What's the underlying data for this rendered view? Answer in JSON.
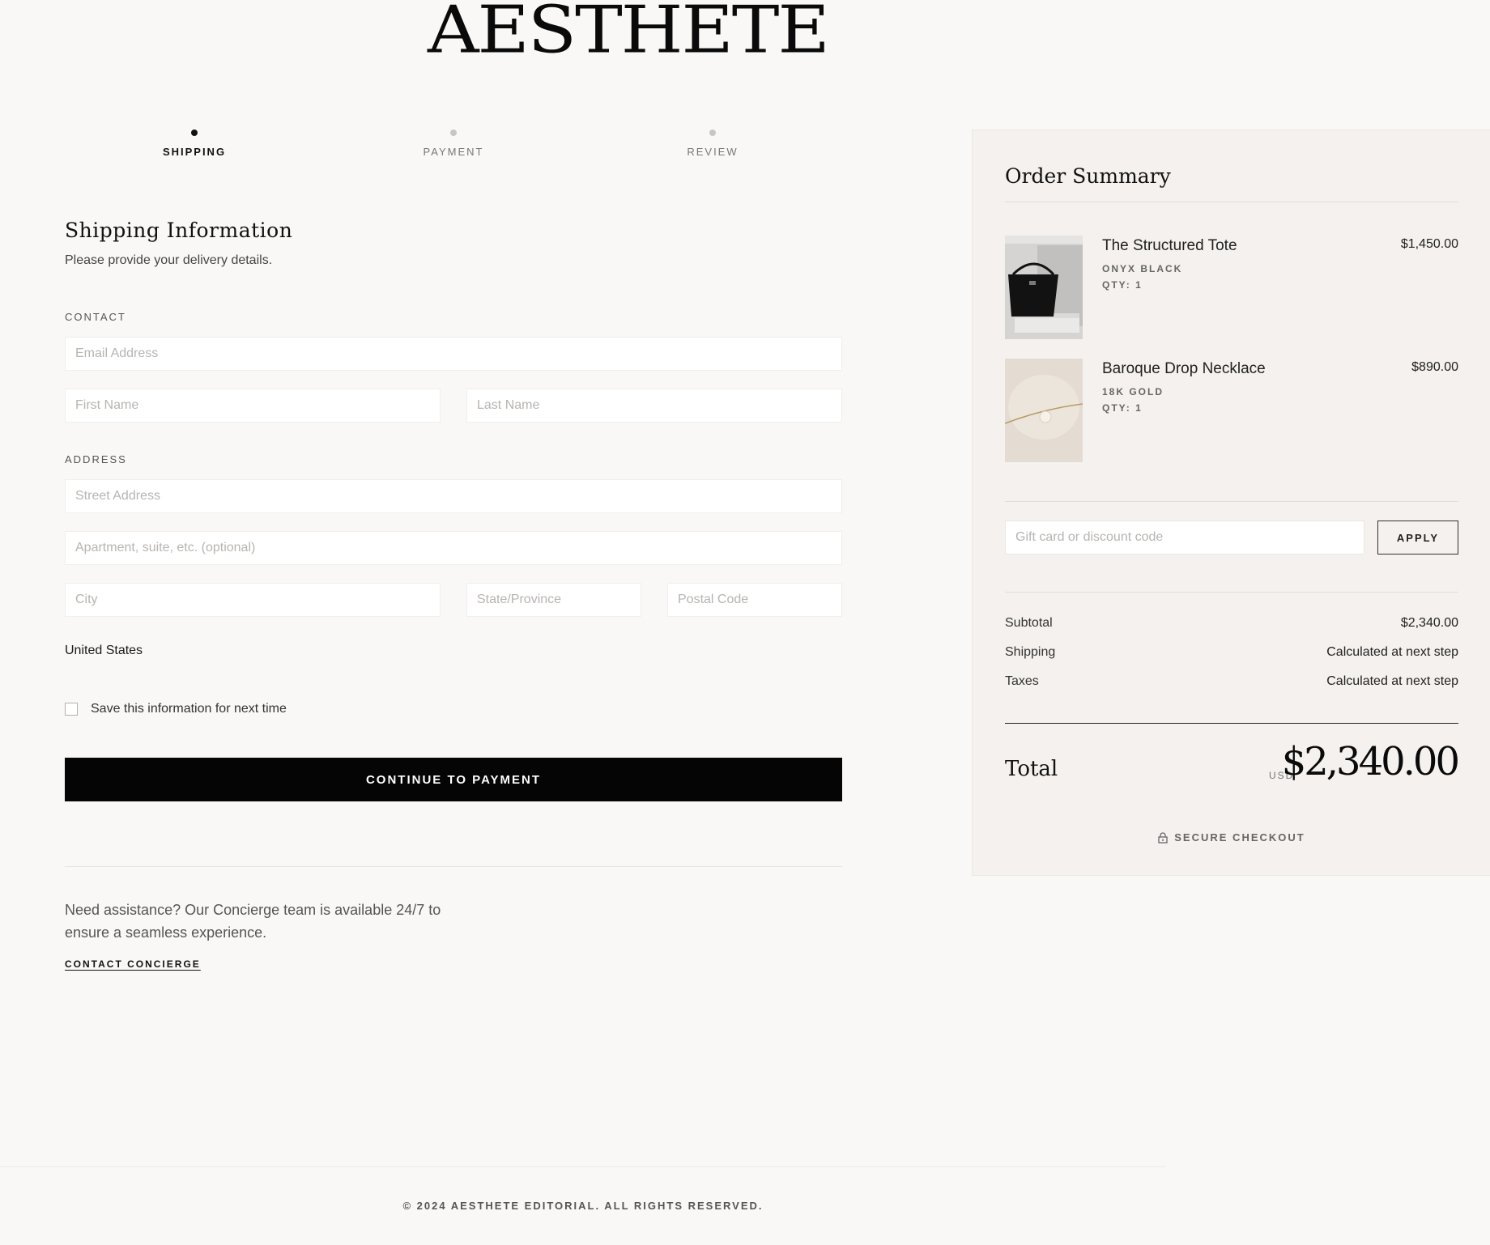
{
  "brand": {
    "name": "AESTHETE"
  },
  "steps": [
    {
      "label": "SHIPPING",
      "active": true
    },
    {
      "label": "PAYMENT",
      "active": false
    },
    {
      "label": "REVIEW",
      "active": false
    }
  ],
  "shipping": {
    "title": "Shipping Information",
    "subtitle": "Please provide your delivery details.",
    "contact_label": "CONTACT",
    "address_label": "ADDRESS",
    "email_placeholder": "Email Address",
    "first_name_placeholder": "First Name",
    "last_name_placeholder": "Last Name",
    "street_placeholder": "Street Address",
    "apartment_placeholder": "Apartment, suite, etc. (optional)",
    "city_placeholder": "City",
    "state_placeholder": "State/Province",
    "postal_placeholder": "Postal Code",
    "country": "United States",
    "save_info_label": "Save this information for next time",
    "continue_label": "CONTINUE TO PAYMENT",
    "assist_text": "Need assistance? Our Concierge team is available 24/7 to ensure a seamless experience.",
    "concierge_link": "CONTACT CONCIERGE"
  },
  "summary": {
    "title": "Order Summary",
    "items": [
      {
        "name": "The Structured Tote",
        "variant": "ONYX BLACK",
        "qty": "QTY: 1",
        "price": "$1,450.00"
      },
      {
        "name": "Baroque Drop Necklace",
        "variant": "18K GOLD",
        "qty": "QTY: 1",
        "price": "$890.00"
      }
    ],
    "discount_placeholder": "Gift card or discount code",
    "apply_label": "APPLY",
    "subtotal_label": "Subtotal",
    "subtotal_value": "$2,340.00",
    "shipping_label": "Shipping",
    "shipping_value": "Calculated at next step",
    "taxes_label": "Taxes",
    "taxes_value": "Calculated at next step",
    "total_label": "Total",
    "currency": "USD",
    "total_value": "$2,340.00",
    "secure_label": "SECURE CHECKOUT"
  },
  "footer": {
    "copyright": "© 2024 AESTHETE EDITORIAL. ALL RIGHTS RESERVED."
  },
  "colors": {
    "background": "#faf8f6",
    "panel": "#f4f1ee",
    "button": "#050505",
    "accent": "#111111"
  }
}
